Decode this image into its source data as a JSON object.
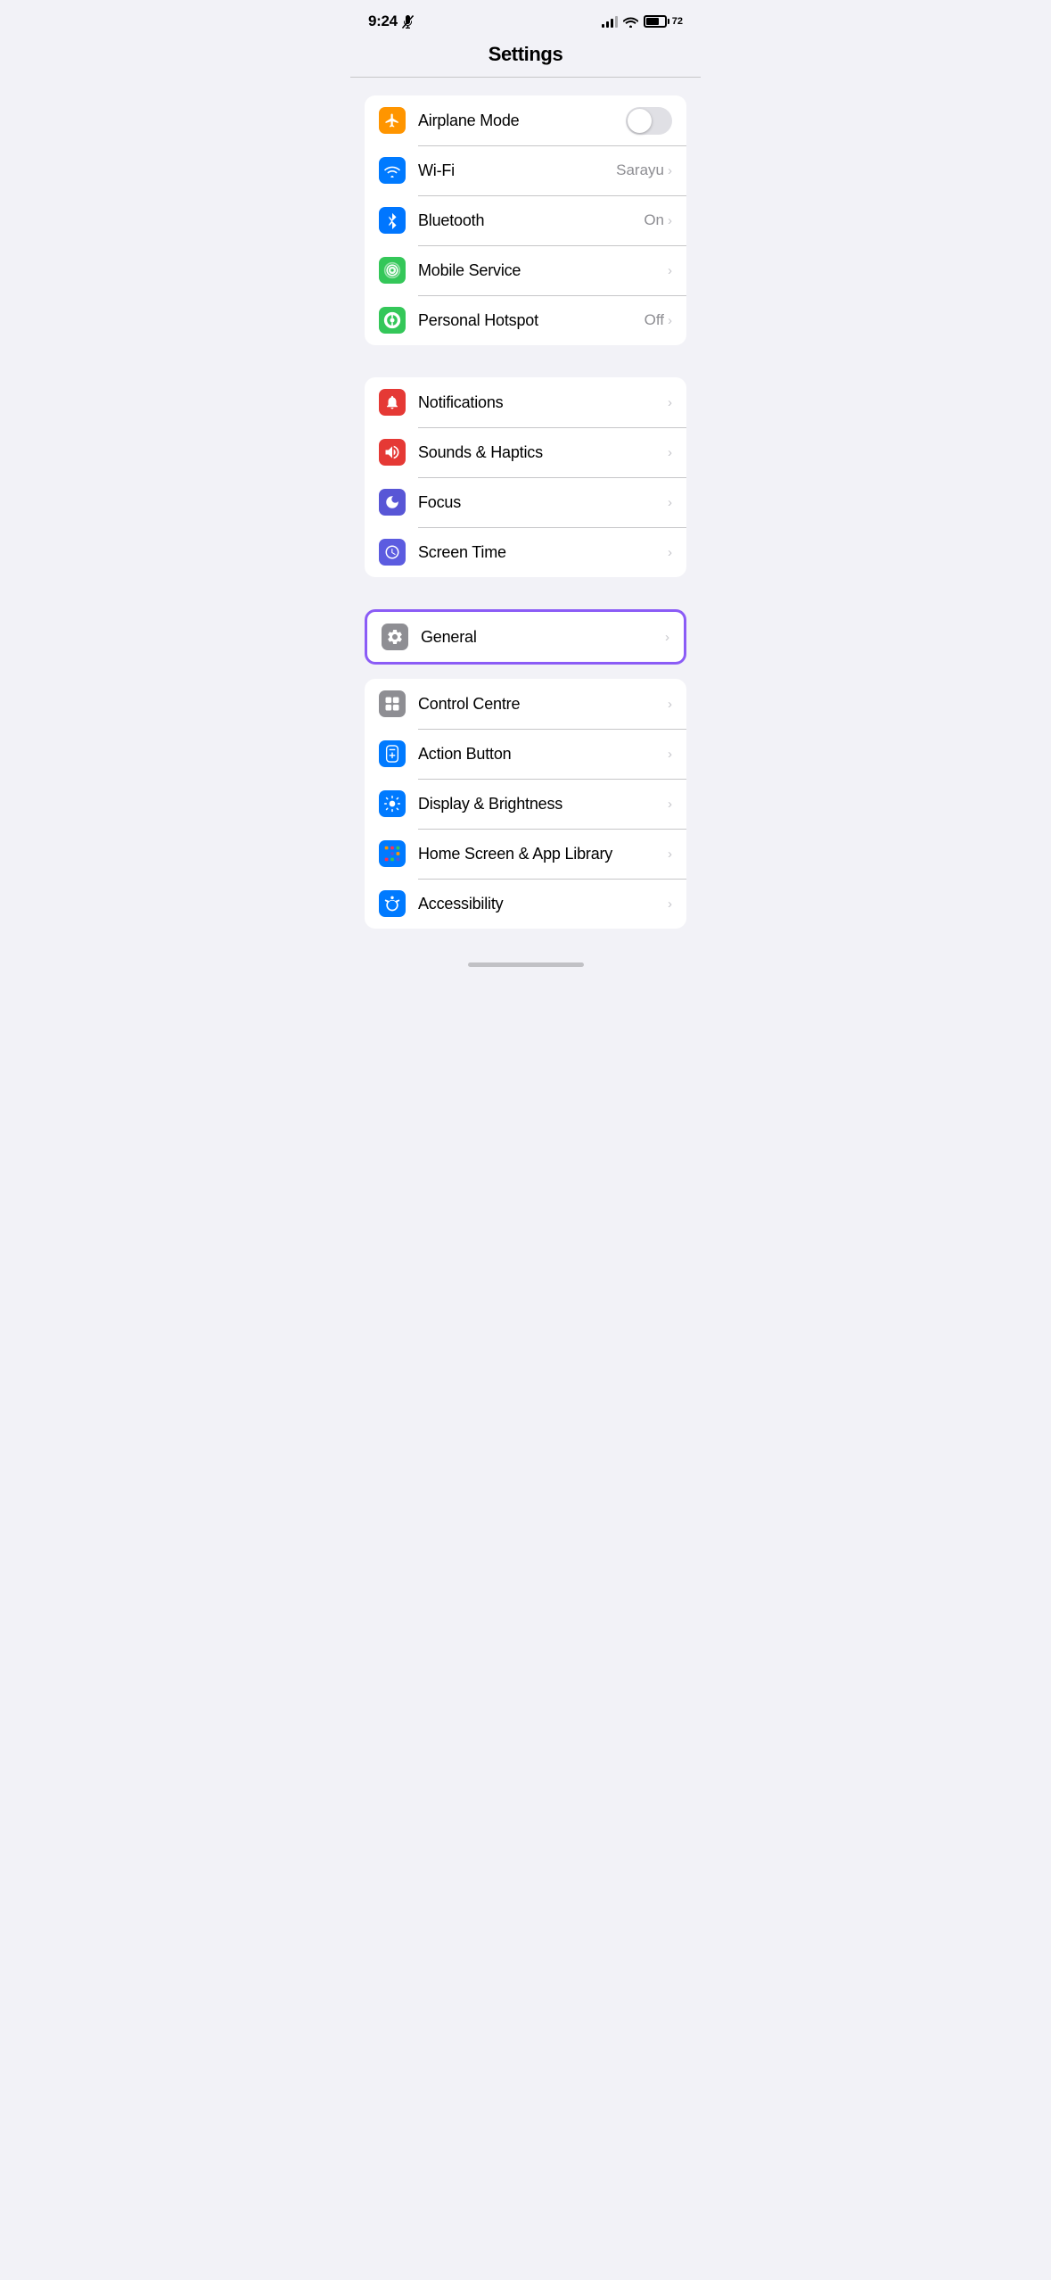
{
  "statusBar": {
    "time": "9:24",
    "batteryLevel": "72"
  },
  "pageTitle": "Settings",
  "groups": [
    {
      "id": "connectivity",
      "highlighted": false,
      "rows": [
        {
          "id": "airplane-mode",
          "label": "Airplane Mode",
          "iconBg": "bg-orange",
          "iconType": "airplane",
          "controlType": "toggle",
          "toggleOn": false,
          "value": "",
          "showChevron": false
        },
        {
          "id": "wifi",
          "label": "Wi-Fi",
          "iconBg": "bg-blue",
          "iconType": "wifi",
          "controlType": "value-chevron",
          "value": "Sarayu",
          "showChevron": true
        },
        {
          "id": "bluetooth",
          "label": "Bluetooth",
          "iconBg": "bg-blue-mid",
          "iconType": "bluetooth",
          "controlType": "value-chevron",
          "value": "On",
          "showChevron": true
        },
        {
          "id": "mobile-service",
          "label": "Mobile Service",
          "iconBg": "bg-green",
          "iconType": "mobile",
          "controlType": "chevron",
          "value": "",
          "showChevron": true
        },
        {
          "id": "personal-hotspot",
          "label": "Personal Hotspot",
          "iconBg": "bg-green",
          "iconType": "hotspot",
          "controlType": "value-chevron",
          "value": "Off",
          "showChevron": true
        }
      ]
    },
    {
      "id": "notifications-group",
      "highlighted": false,
      "rows": [
        {
          "id": "notifications",
          "label": "Notifications",
          "iconBg": "bg-red",
          "iconType": "notifications",
          "controlType": "chevron",
          "value": "",
          "showChevron": true
        },
        {
          "id": "sounds-haptics",
          "label": "Sounds & Haptics",
          "iconBg": "bg-red-sound",
          "iconType": "sound",
          "controlType": "chevron",
          "value": "",
          "showChevron": true
        },
        {
          "id": "focus",
          "label": "Focus",
          "iconBg": "bg-indigo",
          "iconType": "focus",
          "controlType": "chevron",
          "value": "",
          "showChevron": true
        },
        {
          "id": "screen-time",
          "label": "Screen Time",
          "iconBg": "bg-purple",
          "iconType": "screen-time",
          "controlType": "chevron",
          "value": "",
          "showChevron": true
        }
      ]
    },
    {
      "id": "general-group",
      "highlighted": true,
      "rows": [
        {
          "id": "general",
          "label": "General",
          "iconBg": "bg-gray",
          "iconType": "general",
          "controlType": "chevron",
          "value": "",
          "showChevron": true
        }
      ]
    },
    {
      "id": "display-group",
      "highlighted": false,
      "rows": [
        {
          "id": "control-centre",
          "label": "Control Centre",
          "iconBg": "bg-gray",
          "iconType": "control-centre",
          "controlType": "chevron",
          "value": "",
          "showChevron": true
        },
        {
          "id": "action-button",
          "label": "Action Button",
          "iconBg": "bg-blue-action",
          "iconType": "action-button",
          "controlType": "chevron",
          "value": "",
          "showChevron": true
        },
        {
          "id": "display-brightness",
          "label": "Display & Brightness",
          "iconBg": "bg-blue-display",
          "iconType": "display",
          "controlType": "chevron",
          "value": "",
          "showChevron": true
        },
        {
          "id": "home-screen",
          "label": "Home Screen & App Library",
          "iconBg": "bg-blue-home",
          "iconType": "home-screen",
          "controlType": "chevron",
          "value": "",
          "showChevron": true
        },
        {
          "id": "accessibility",
          "label": "Accessibility",
          "iconBg": "bg-blue-access",
          "iconType": "accessibility",
          "controlType": "chevron",
          "value": "",
          "showChevron": true
        }
      ]
    }
  ]
}
